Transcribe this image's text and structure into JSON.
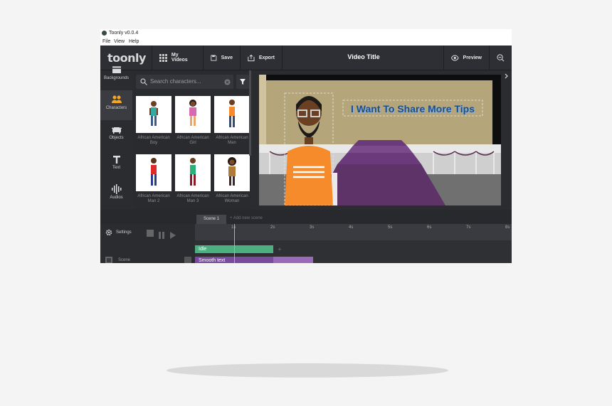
{
  "window": {
    "title": "Toonly v0.0.4"
  },
  "menu": [
    "File",
    "View",
    "Help"
  ],
  "toolbar": {
    "brand": "toonly",
    "my_videos": "My Videos",
    "save": "Save",
    "export": "Export",
    "video_title": "Video Title",
    "preview": "Preview"
  },
  "sidebar": [
    {
      "label": "Backgrounds",
      "icon": "backgrounds-icon"
    },
    {
      "label": "Characters",
      "icon": "characters-icon"
    },
    {
      "label": "Objects",
      "icon": "objects-icon"
    },
    {
      "label": "Text",
      "icon": "text-icon"
    },
    {
      "label": "Audios",
      "icon": "audios-icon"
    }
  ],
  "panel": {
    "search_placeholder": "Search characters...",
    "characters": [
      {
        "label": "African American Boy"
      },
      {
        "label": "African American Girl"
      },
      {
        "label": "African American Man"
      },
      {
        "label": "African American Man 2"
      },
      {
        "label": "African American Man 3"
      },
      {
        "label": "African American Woman"
      }
    ]
  },
  "canvas": {
    "text": "I Want To Share More Tips"
  },
  "timeline": {
    "scene_tab": "Scene 1",
    "add_scene": "Add new scene",
    "settings": "Settings",
    "scene_label": "Scene",
    "ticks": [
      "1s",
      "2s",
      "3s",
      "4s",
      "5s",
      "6s",
      "7s",
      "8s"
    ],
    "tracks": [
      {
        "label": "Idle",
        "color": "#4caf80"
      },
      {
        "label": "Smooth text",
        "color": "#7a4a9c"
      }
    ]
  },
  "colors": {
    "accent": "#f5a623",
    "toolbar": "#2e2f34"
  }
}
